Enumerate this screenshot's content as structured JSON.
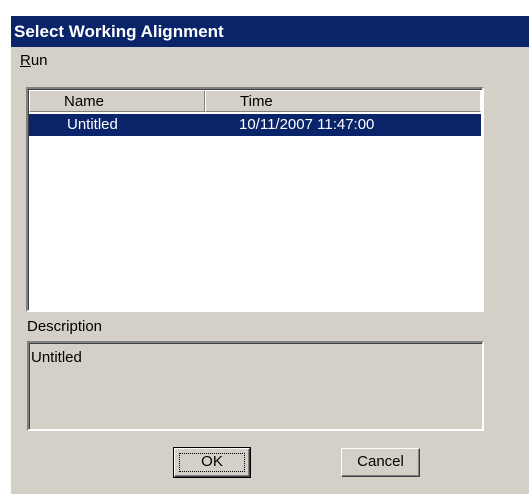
{
  "window": {
    "title": "Select Working Alignment"
  },
  "menu": {
    "items": [
      {
        "label_underlined": "R",
        "label_rest": "un"
      }
    ]
  },
  "list": {
    "columns": [
      "Name",
      "Time"
    ],
    "rows": [
      {
        "name": "Untitled",
        "time": "10/11/2007 11:47:00",
        "selected": true
      }
    ]
  },
  "description": {
    "label": "Description",
    "value": "Untitled"
  },
  "buttons": {
    "ok": "OK",
    "cancel": "Cancel"
  },
  "colors": {
    "titlebar": "#0a246a",
    "face": "#d4d0c8",
    "selection": "#0a246a"
  }
}
